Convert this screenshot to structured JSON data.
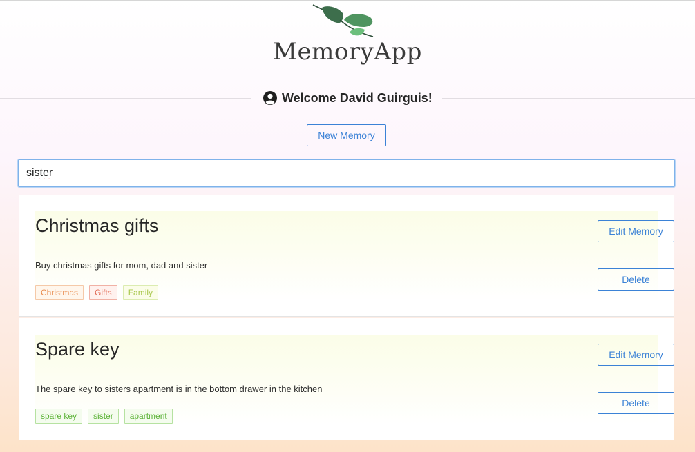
{
  "app": {
    "name": "MemoryApp"
  },
  "welcome": {
    "text": "Welcome David Guirguis!"
  },
  "actions": {
    "new_memory_label": "New Memory"
  },
  "search": {
    "value": "sister"
  },
  "memories": [
    {
      "title": "Christmas gifts",
      "description": "Buy christmas gifts for mom, dad and sister",
      "edit_label": "Edit Memory",
      "delete_label": "Delete",
      "tags": [
        {
          "label": "Christmas",
          "color": "#e8894a",
          "border": "#f5c9a8",
          "bg": "#fff6ec"
        },
        {
          "label": "Gifts",
          "color": "#e0654f",
          "border": "#f1b1a5",
          "bg": "#fff1ee"
        },
        {
          "label": "Family",
          "color": "#a7c64a",
          "border": "#dcecb1",
          "bg": "#fbfde9"
        }
      ]
    },
    {
      "title": "Spare key",
      "description": "The spare key to sisters apartment is in the bottom drawer in the kitchen",
      "edit_label": "Edit Memory",
      "delete_label": "Delete",
      "tags": [
        {
          "label": "spare key",
          "color": "#5cb338",
          "border": "#b6e2a1",
          "bg": "#f4fcee"
        },
        {
          "label": "sister",
          "color": "#5cb338",
          "border": "#b6e2a1",
          "bg": "#f4fcee"
        },
        {
          "label": "apartment",
          "color": "#5cb338",
          "border": "#b6e2a1",
          "bg": "#f4fcee"
        }
      ]
    }
  ],
  "colors": {
    "accent": "#3b82d6",
    "logo_leaf_dark": "#3d6e4c",
    "logo_leaf_light": "#5aa469"
  },
  "icons": {
    "logo": "leaves-logo-icon",
    "user": "user-circle-icon"
  }
}
